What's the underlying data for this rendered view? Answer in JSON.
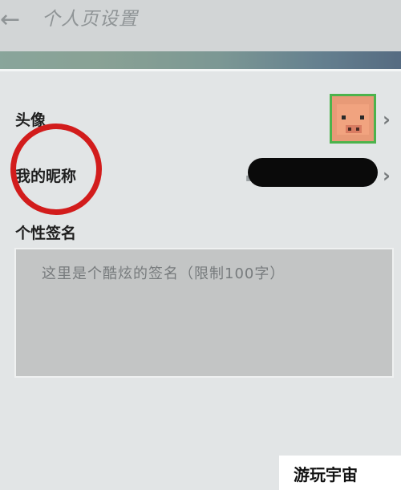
{
  "header": {
    "back_icon": "arrow-left-icon",
    "title": "个人页设置"
  },
  "rows": {
    "avatar": {
      "label": "头像",
      "icon": "pig-avatar-icon"
    },
    "nickname": {
      "label": "我的昵称",
      "value_redacted": true
    },
    "signature": {
      "label": "个性签名"
    }
  },
  "signature_input": {
    "placeholder": "这里是个酷炫的签名（限制100字）"
  },
  "watermark": {
    "text": "游玩宇宙"
  },
  "colors": {
    "annotation_circle": "#d21c1c",
    "avatar_border": "#4cb34c"
  }
}
